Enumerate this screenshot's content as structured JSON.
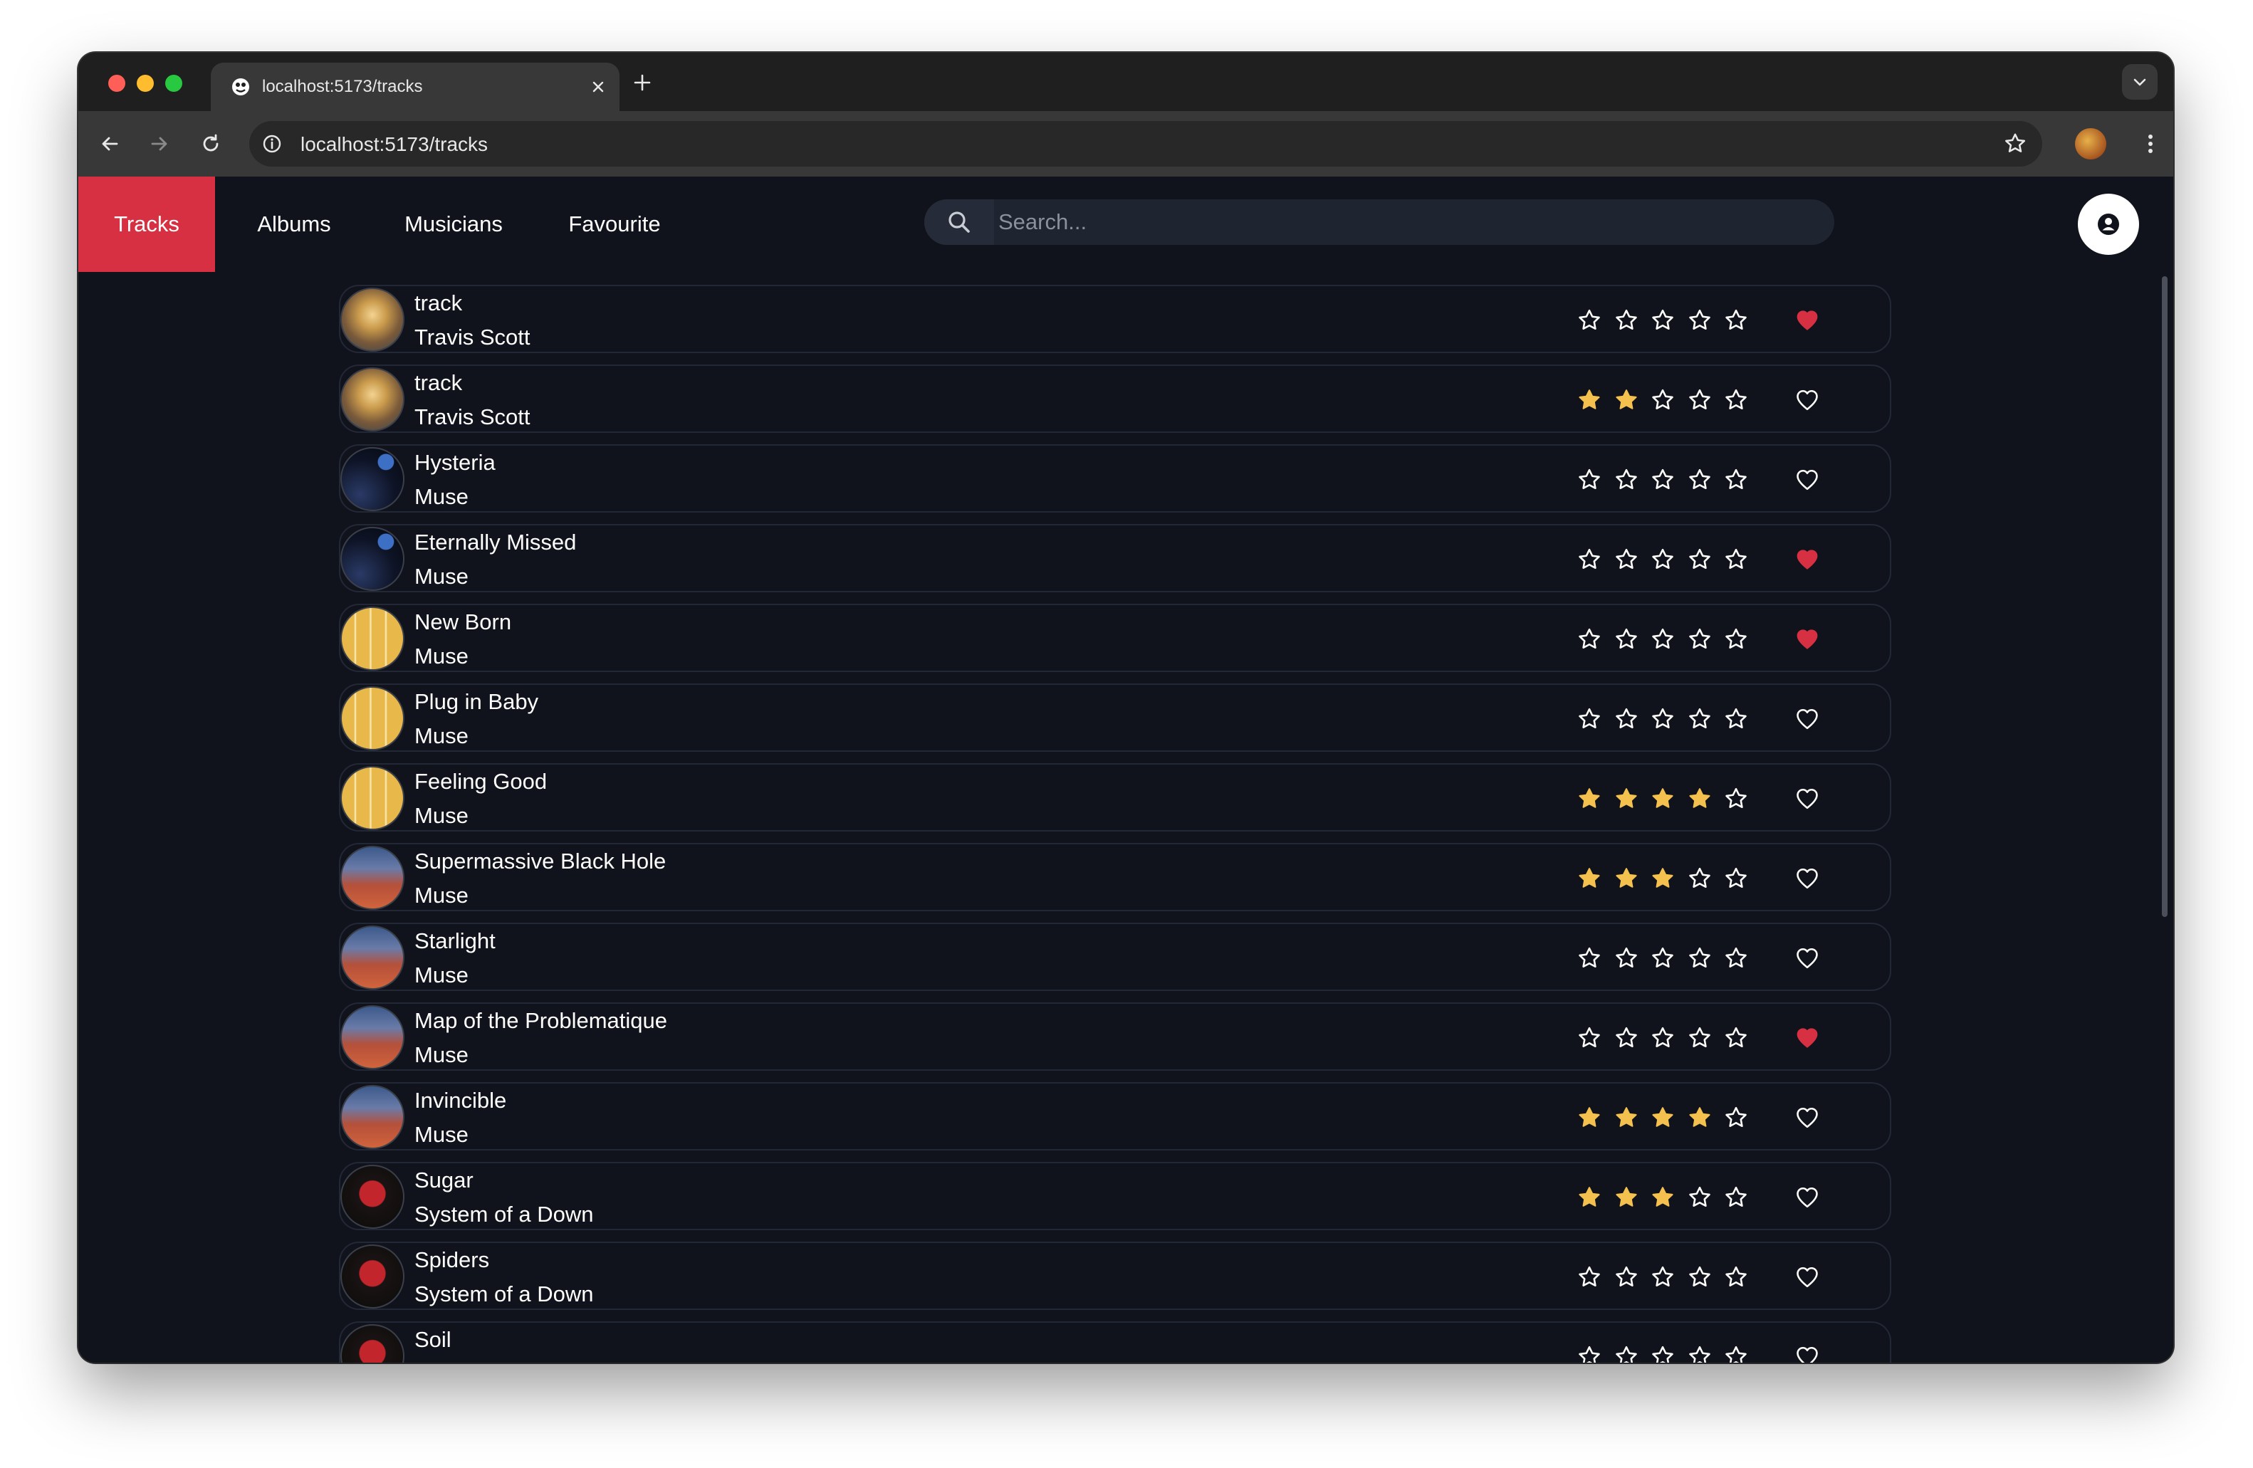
{
  "browser": {
    "tab_title": "localhost:5173/tracks",
    "url": "localhost:5173/tracks",
    "icons": [
      "close-icon",
      "plus-icon",
      "chevron-down-icon",
      "back-icon",
      "forward-icon",
      "reload-icon",
      "info-icon",
      "bookmark-star-icon",
      "menu-kebab-icon"
    ]
  },
  "nav": {
    "items": [
      {
        "label": "Tracks",
        "active": true
      },
      {
        "label": "Albums",
        "active": false
      },
      {
        "label": "Musicians",
        "active": false
      },
      {
        "label": "Favourite",
        "active": false
      }
    ],
    "accent_color": "#d63042"
  },
  "search": {
    "placeholder": "Search...",
    "value": "",
    "icon": "search-icon"
  },
  "user": {
    "icon": "user-icon"
  },
  "colors": {
    "background": "#10131b",
    "star_filled": "#f4c04e",
    "star_empty": "#ffffff",
    "heart_filled": "#d63042",
    "heart_empty": "#ffffff"
  },
  "tracks": [
    {
      "title": "track",
      "artist": "Travis Scott",
      "cover": "c-astro",
      "rating": 0,
      "favourite": true
    },
    {
      "title": "track",
      "artist": "Travis Scott",
      "cover": "c-astro",
      "rating": 2,
      "favourite": false
    },
    {
      "title": "Hysteria",
      "artist": "Muse",
      "cover": "c-hyst",
      "rating": 0,
      "favourite": false
    },
    {
      "title": "Eternally Missed",
      "artist": "Muse",
      "cover": "c-hyst",
      "rating": 0,
      "favourite": true
    },
    {
      "title": "New Born",
      "artist": "Muse",
      "cover": "c-origin",
      "rating": 0,
      "favourite": true
    },
    {
      "title": "Plug in Baby",
      "artist": "Muse",
      "cover": "c-origin",
      "rating": 0,
      "favourite": false
    },
    {
      "title": "Feeling Good",
      "artist": "Muse",
      "cover": "c-origin",
      "rating": 4,
      "favourite": false
    },
    {
      "title": "Supermassive Black Hole",
      "artist": "Muse",
      "cover": "c-bhr",
      "rating": 3,
      "favourite": false
    },
    {
      "title": "Starlight",
      "artist": "Muse",
      "cover": "c-bhr",
      "rating": 0,
      "favourite": false
    },
    {
      "title": "Map of the Problematique",
      "artist": "Muse",
      "cover": "c-bhr",
      "rating": 0,
      "favourite": true
    },
    {
      "title": "Invincible",
      "artist": "Muse",
      "cover": "c-bhr",
      "rating": 4,
      "favourite": false
    },
    {
      "title": "Sugar",
      "artist": "System of a Down",
      "cover": "c-tox",
      "rating": 3,
      "favourite": false
    },
    {
      "title": "Spiders",
      "artist": "System of a Down",
      "cover": "c-tox",
      "rating": 0,
      "favourite": false
    },
    {
      "title": "Soil",
      "artist": "",
      "cover": "c-tox",
      "rating": 0,
      "favourite": false
    }
  ]
}
